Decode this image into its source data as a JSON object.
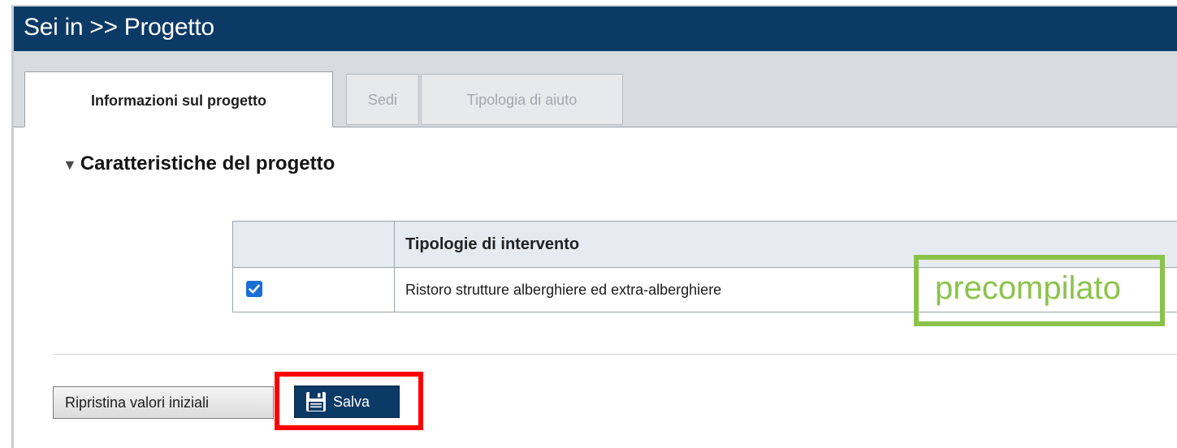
{
  "header": {
    "title": "Sei in >> Progetto",
    "background_color": "#0c3a66"
  },
  "tabs": [
    {
      "label": "Informazioni sul progetto",
      "active": true
    },
    {
      "label": "Sedi",
      "active": false
    },
    {
      "label": "Tipologia di aiuto",
      "active": false
    }
  ],
  "section": {
    "toggle_icon": "triangle-down-icon",
    "title": "Caratteristiche del progetto"
  },
  "table": {
    "columns": [
      "",
      "Tipologie di intervento"
    ],
    "rows": [
      {
        "checked": true,
        "label": "Ristoro strutture alberghiere ed extra-alberghiere"
      }
    ]
  },
  "annotations": {
    "prefilled_label": "precompilato",
    "prefilled_color": "#8bc34a",
    "highlight_color": "#ff0000"
  },
  "buttons": {
    "reset_label": "Ripristina valori iniziali",
    "save_label": "Salva",
    "save_icon": "floppy-disk-icon"
  }
}
